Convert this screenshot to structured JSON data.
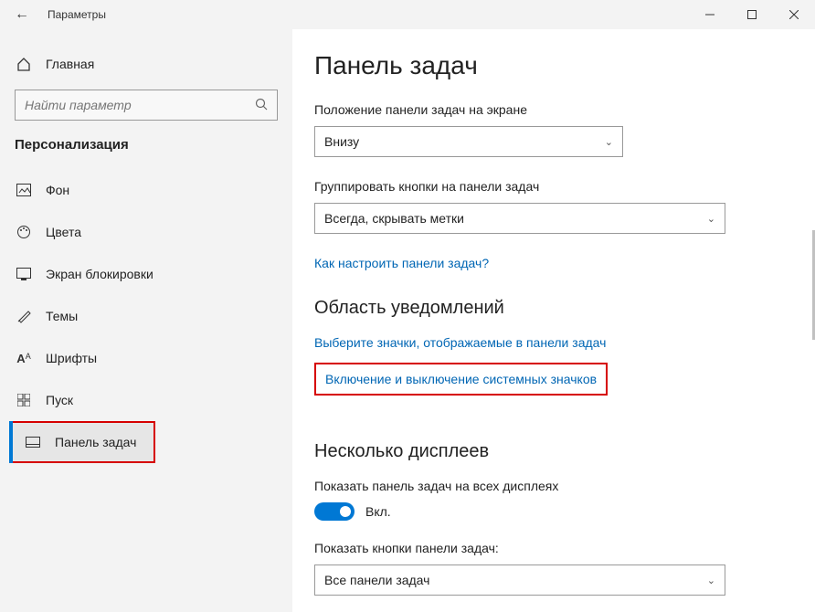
{
  "window": {
    "title": "Параметры"
  },
  "sidebar": {
    "home": "Главная",
    "search_placeholder": "Найти параметр",
    "category": "Персонализация",
    "items": [
      {
        "label": "Фон"
      },
      {
        "label": "Цвета"
      },
      {
        "label": "Экран блокировки"
      },
      {
        "label": "Темы"
      },
      {
        "label": "Шрифты"
      },
      {
        "label": "Пуск"
      },
      {
        "label": "Панель задач"
      }
    ]
  },
  "main": {
    "heading": "Панель задач",
    "position_label": "Положение панели задач на экране",
    "position_value": "Внизу",
    "group_label": "Группировать кнопки на панели задач",
    "group_value": "Всегда, скрывать метки",
    "customize_link": "Как настроить панели задач?",
    "notif_heading": "Область уведомлений",
    "select_icons_link": "Выберите значки, отображаемые в панели задач",
    "system_icons_link": "Включение и выключение системных значков",
    "multidisplay_heading": "Несколько дисплеев",
    "show_all_label": "Показать панель задач на всех дисплеях",
    "toggle_on_label": "Вкл.",
    "show_buttons_label": "Показать кнопки панели задач:",
    "show_buttons_value": "Все панели задач"
  }
}
